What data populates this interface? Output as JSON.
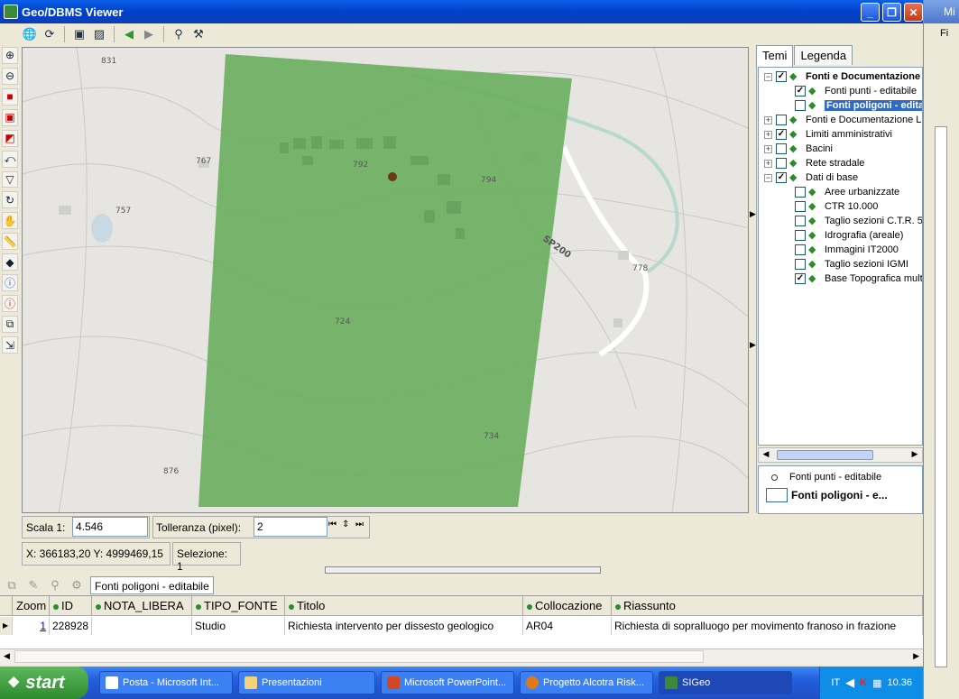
{
  "window": {
    "title": "Geo/DBMS Viewer",
    "min": "_",
    "max": "❐",
    "close": "✕"
  },
  "right_strip": {
    "title": "Mi",
    "menu": "Fi"
  },
  "toolbar": [
    "globe-icon",
    "refresh-icon",
    "camera-icon",
    "image-icon",
    "back-arrow-icon",
    "forward-arrow-icon",
    "binoculars-icon",
    "tools-icon"
  ],
  "lefttools": [
    "zoom-in-icon",
    "zoom-out-icon",
    "zoom-layer-icon",
    "zoom-extent-icon",
    "zoom-selection-icon",
    "zoom-previous-icon",
    "filter-icon",
    "refresh-layer-icon",
    "pan-hand-icon",
    "measure-icon",
    "erase-icon",
    "info-icon",
    "info-red-icon",
    "layer-info-icon",
    "export-icon"
  ],
  "map": {
    "contours": [
      "831",
      "767",
      "792",
      "794",
      "757",
      "SP200",
      "778",
      "724",
      "734",
      "876"
    ]
  },
  "panel": {
    "tabs": [
      "Temi",
      "Legenda"
    ],
    "tree": [
      {
        "label": "Fonti e Documentazione",
        "exp": "−",
        "checked": true,
        "bold": true,
        "indent": 0
      },
      {
        "label": "Fonti punti - editabile",
        "checked": true,
        "indent": 1
      },
      {
        "label": "Fonti poligoni - editabile",
        "checked": false,
        "indent": 1,
        "selected": true
      },
      {
        "label": "Fonti e Documentazione L",
        "exp": "+",
        "checked": false,
        "indent": 0
      },
      {
        "label": "Limiti amministrativi",
        "exp": "+",
        "checked": true,
        "indent": 0
      },
      {
        "label": "Bacini",
        "exp": "+",
        "checked": false,
        "indent": 0
      },
      {
        "label": "Rete stradale",
        "exp": "+",
        "checked": false,
        "indent": 0
      },
      {
        "label": "Dati di base",
        "exp": "−",
        "checked": true,
        "indent": 0
      },
      {
        "label": "Aree urbanizzate",
        "checked": false,
        "indent": 1
      },
      {
        "label": "CTR 10.000",
        "checked": false,
        "indent": 1
      },
      {
        "label": "Taglio sezioni C.T.R. 5",
        "checked": false,
        "indent": 1
      },
      {
        "label": "Idrografia (areale)",
        "checked": false,
        "indent": 1
      },
      {
        "label": "Immagini IT2000",
        "checked": false,
        "indent": 1
      },
      {
        "label": "Taglio sezioni IGMI",
        "checked": false,
        "indent": 1
      },
      {
        "label": "Base Topografica mult",
        "checked": true,
        "indent": 1
      }
    ],
    "legend": [
      "Fonti punti - editabile",
      "Fonti poligoni - e..."
    ]
  },
  "scale": {
    "label": "Scala 1:",
    "value": "4.546",
    "tol_label": "Tolleranza (pixel):",
    "tol_value": "2"
  },
  "coords": {
    "xy": "X: 366183,20 Y: 4999469,15",
    "selection": "Selezione: 1"
  },
  "layer_tab": "Fonti poligoni - editabile",
  "table": {
    "headers": [
      "Zoom",
      "ID",
      "NOTA_LIBERA",
      "TIPO_FONTE",
      "Titolo",
      "Collocazione",
      "Riassunto"
    ],
    "row": [
      "1",
      "228928",
      "",
      "Studio",
      "Richiesta intervento per dissesto geologico",
      "AR04",
      "Richiesta di sopralluogo per movimento franoso in frazione"
    ]
  },
  "taskbar": {
    "start": "start",
    "tasks": [
      "Posta - Microsoft Int...",
      "Presentazioni",
      "Microsoft PowerPoint...",
      "Progetto Alcotra Risk...",
      "SIGeo"
    ],
    "tray_lang": "IT",
    "clock": "10.36"
  }
}
